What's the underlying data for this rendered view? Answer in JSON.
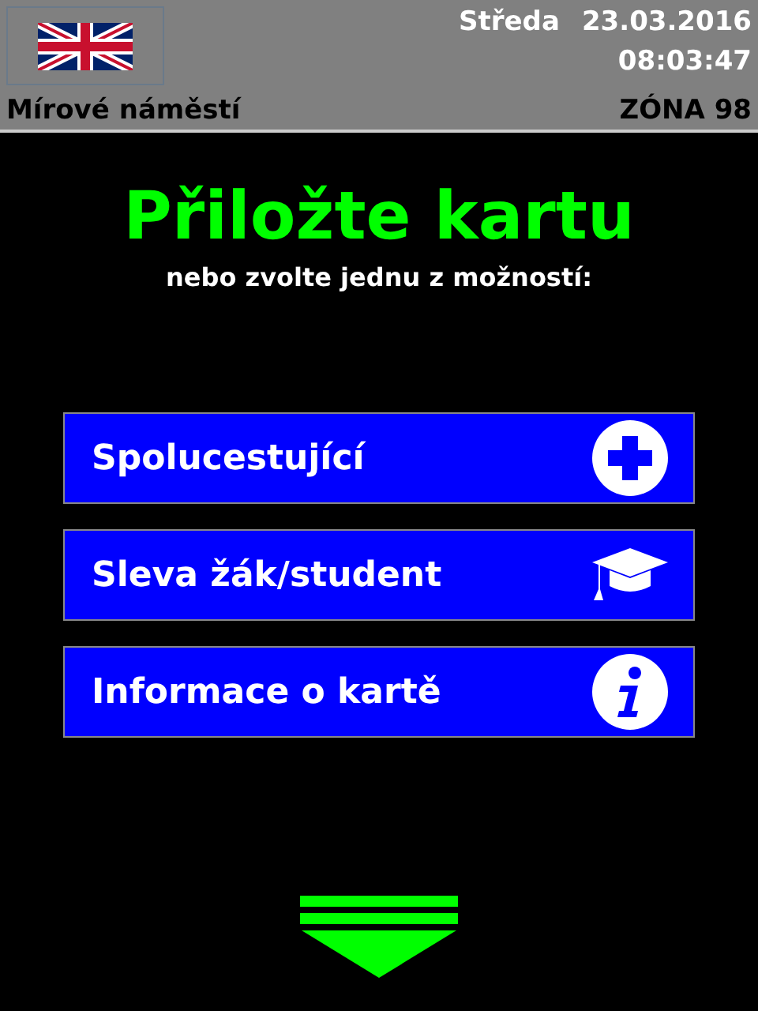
{
  "header": {
    "day": "Středa",
    "date": "23.03.2016",
    "time": "08:03:47",
    "stop": "Mírové náměstí",
    "zone": "ZÓNA 98"
  },
  "title": "Přiložte kartu",
  "subtitle": "nebo zvolte jednu z možností:",
  "options": [
    {
      "label": "Spolucestující",
      "kind": "plus"
    },
    {
      "label": "Sleva žák/student",
      "kind": "cap"
    },
    {
      "label": "Informace o kartě",
      "kind": "info"
    }
  ]
}
